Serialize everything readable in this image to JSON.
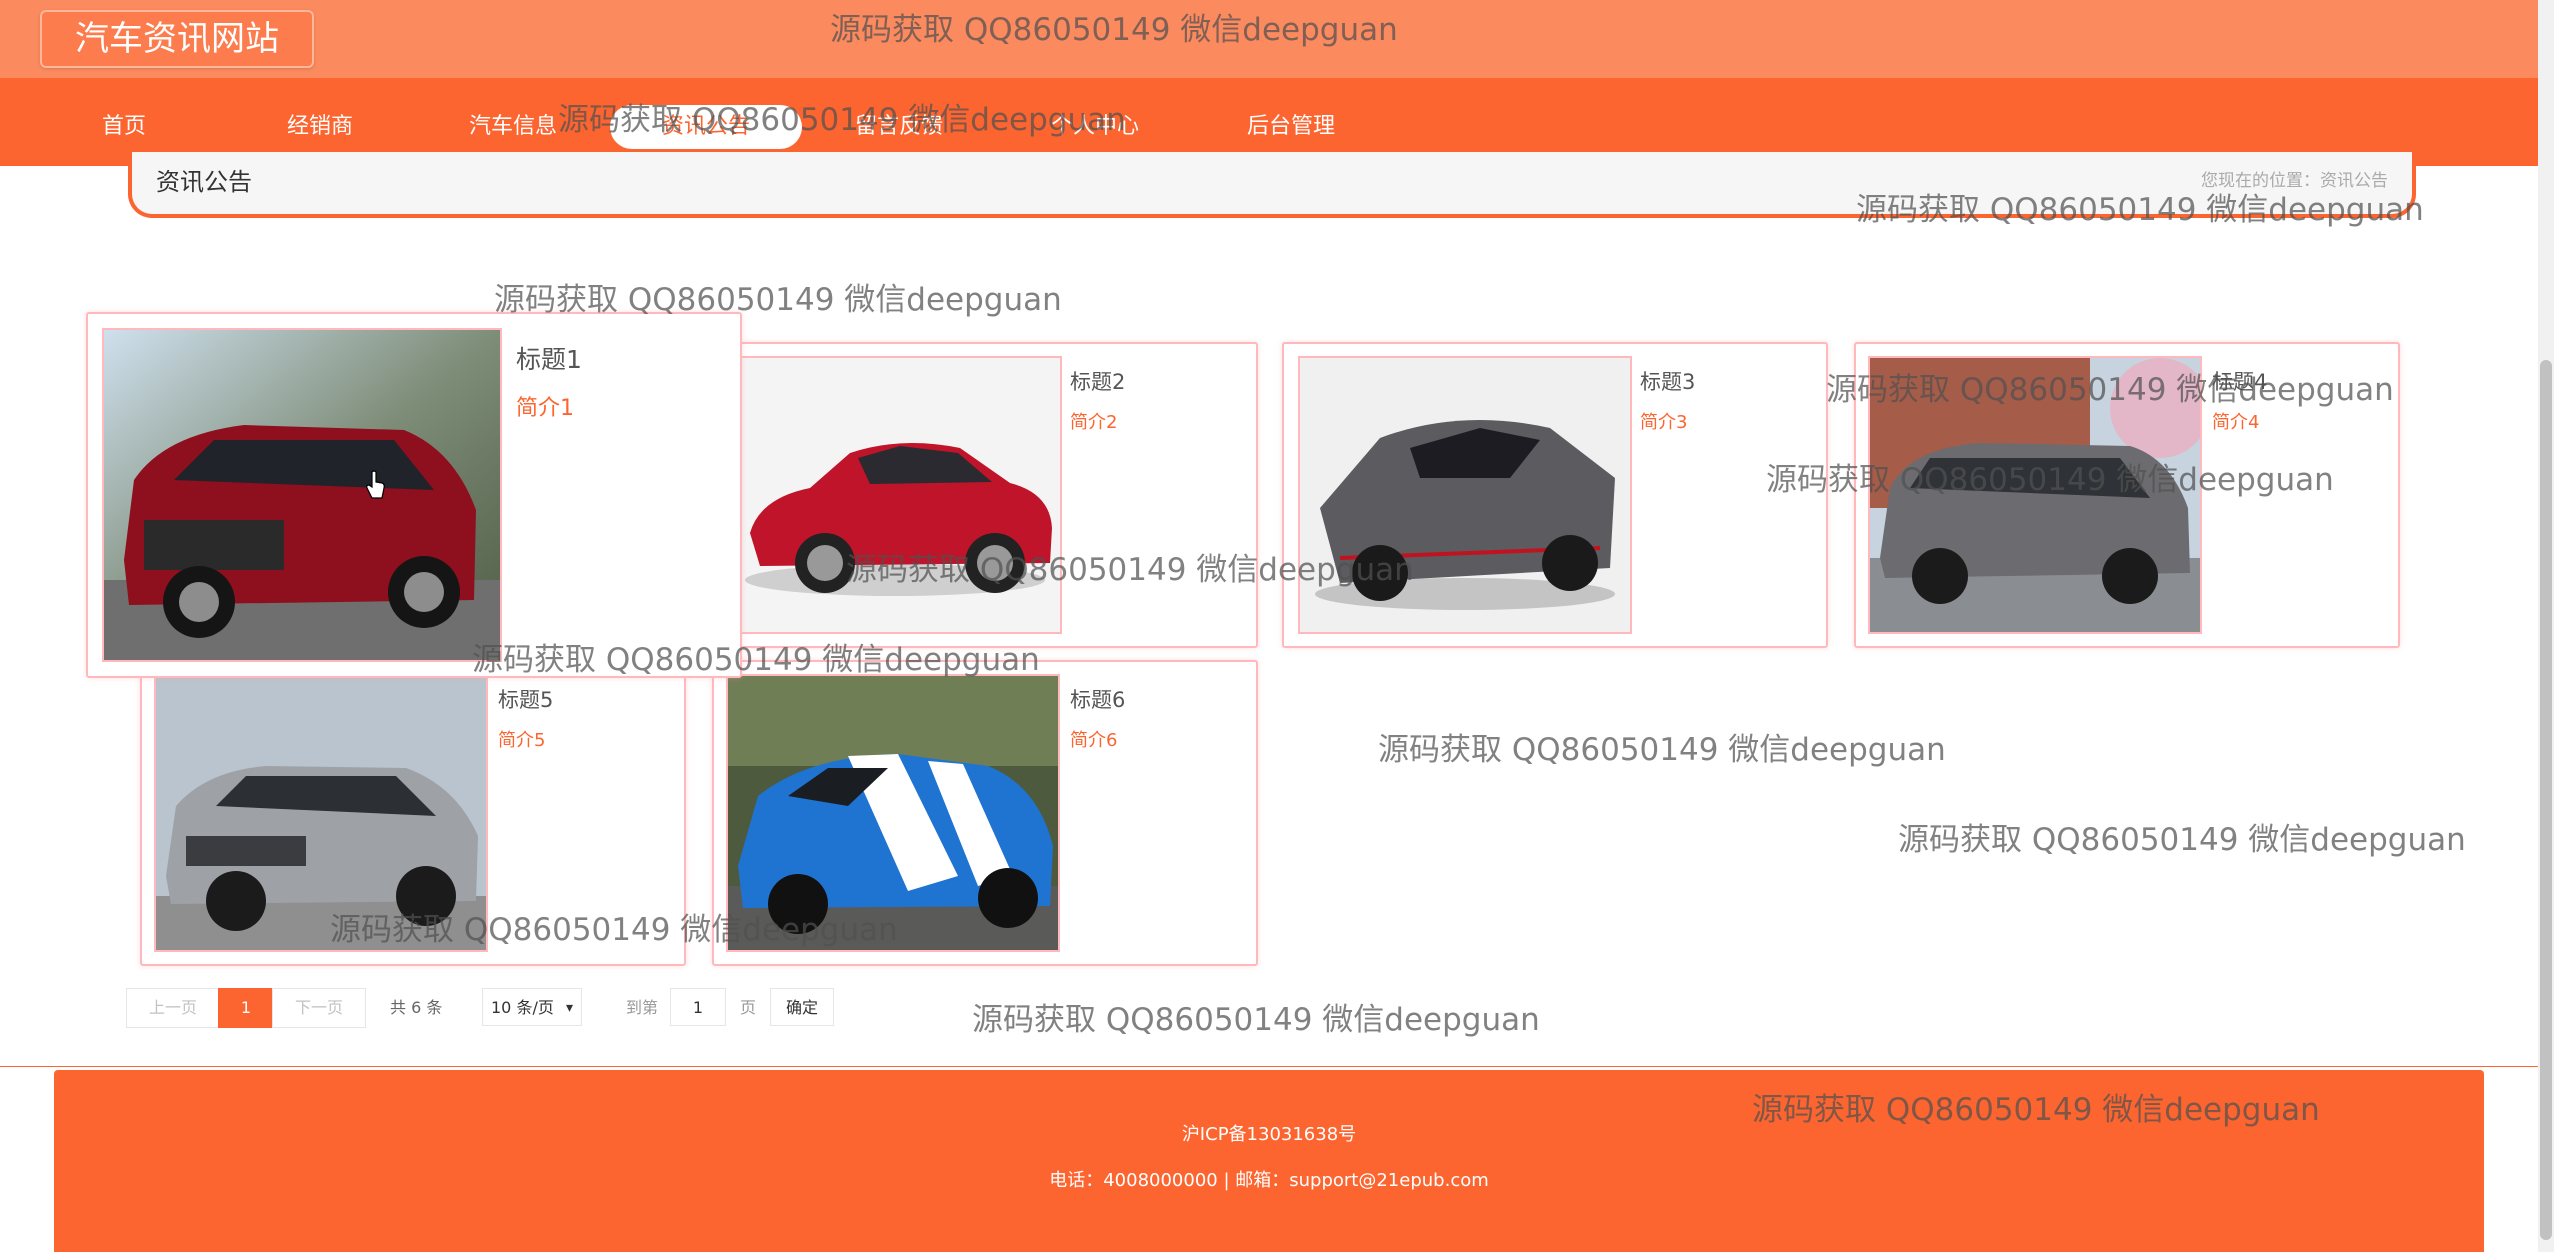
{
  "site": {
    "logo": "汽车资讯网站"
  },
  "nav": [
    {
      "label": "首页",
      "active": false
    },
    {
      "label": "经销商",
      "active": false
    },
    {
      "label": "汽车信息",
      "active": false
    },
    {
      "label": "资讯公告",
      "active": true
    },
    {
      "label": "留言反馈",
      "active": false
    },
    {
      "label": "个人中心",
      "active": false
    },
    {
      "label": "后台管理",
      "active": false
    }
  ],
  "breadcrumb": {
    "title": "资讯公告",
    "position": "您现在的位置：资讯公告"
  },
  "articles": [
    {
      "title": "标题1",
      "intro": "简介1",
      "image": "red-suv"
    },
    {
      "title": "标题2",
      "intro": "简介2",
      "image": "red-sedan"
    },
    {
      "title": "标题3",
      "intro": "简介3",
      "image": "silver-supercar"
    },
    {
      "title": "标题4",
      "intro": "简介4",
      "image": "grey-minivan"
    },
    {
      "title": "标题5",
      "intro": "简介5",
      "image": "silver-suv"
    },
    {
      "title": "标题6",
      "intro": "简介6",
      "image": "blue-muscle-car"
    }
  ],
  "pagination": {
    "prev": "上一页",
    "current": "1",
    "next": "下一页",
    "total": "共 6 条",
    "page_size": "10 条/页",
    "goto": "到第",
    "goto_value": "1",
    "page_unit": "页",
    "confirm": "确定"
  },
  "footer": {
    "icp": "沪ICP备13031638号",
    "contact": "电话：4008000000 | 邮箱：support@21epub.com"
  },
  "watermark": "源码获取 QQ86050149 微信deepguan",
  "colors": {
    "primary": "#fc6530",
    "header": "#fc8a5f",
    "card_border": "#ffb9bd"
  }
}
